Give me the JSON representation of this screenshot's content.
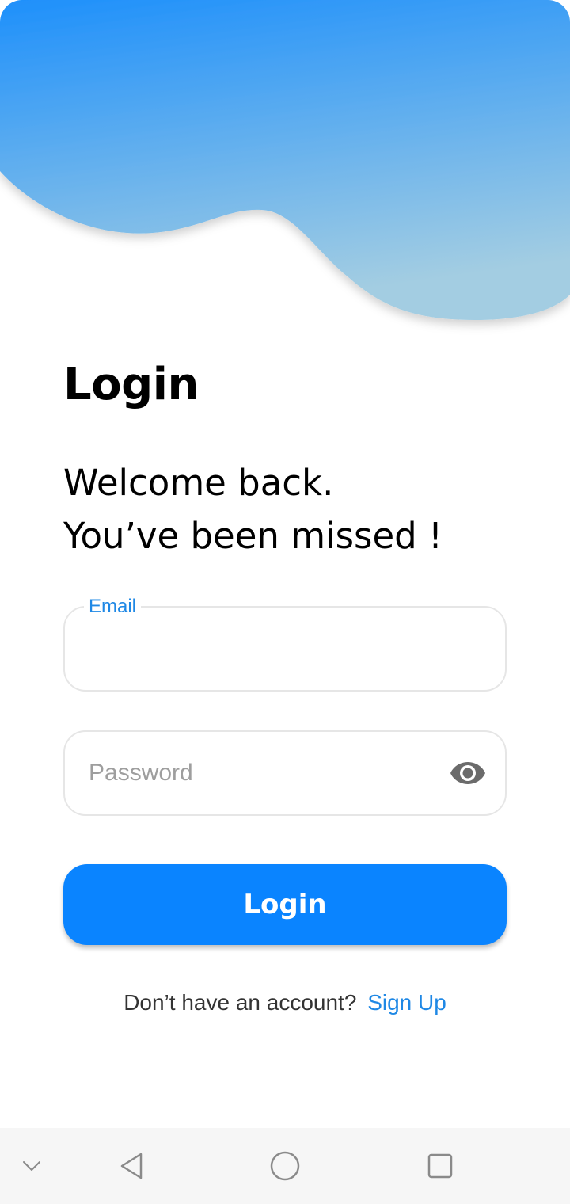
{
  "colors": {
    "wave_top": "#1e90fb",
    "wave_bottom": "#9ecde3",
    "primary": "#0a84ff",
    "link": "#1f88e5",
    "field_border": "#e6e6e6",
    "placeholder": "#9e9e9e",
    "eye_icon": "#6b6b6b",
    "navbar_bg": "#f6f6f6"
  },
  "header": {
    "title": "Login",
    "subtitle_line1": "Welcome back.",
    "subtitle_line2": "You’ve been missed !"
  },
  "form": {
    "email": {
      "label": "Email",
      "value": ""
    },
    "password": {
      "placeholder": "Password",
      "value": "",
      "toggle_icon": "eye-icon"
    },
    "submit_label": "Login"
  },
  "footer": {
    "prompt": "Don’t have an account?",
    "signup_label": "Sign Up"
  },
  "system_nav": {
    "icons": [
      "chevron-down-icon",
      "back-triangle-icon",
      "home-circle-icon",
      "recents-square-icon"
    ]
  }
}
